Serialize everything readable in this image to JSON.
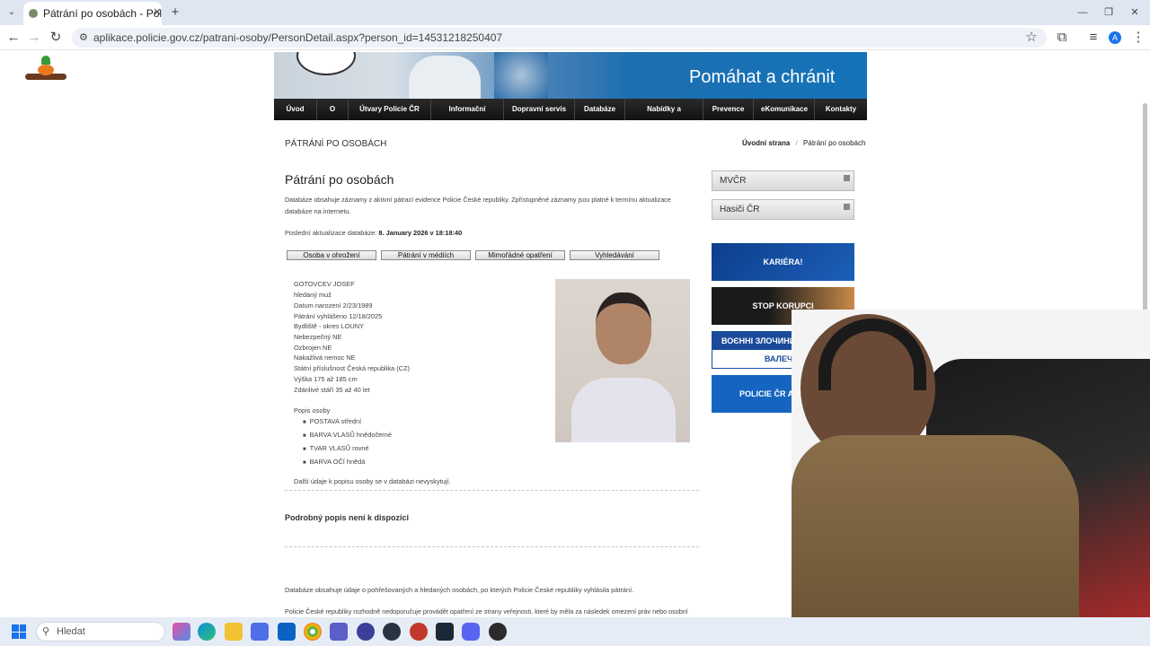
{
  "browser": {
    "tab_title": "Pátrání po osobách - Policie Če",
    "url": "aplikace.policie.gov.cz/patrani-osoby/PersonDetail.aspx?person_id=14531218250407",
    "new_tab": "+",
    "minimize": "—",
    "restore": "❐",
    "close": "✕",
    "profile": "A"
  },
  "header": {
    "slogan": "Pomáhat a chránit",
    "nav": [
      "Úvod",
      "O nás",
      "Útvary Policie ČR",
      "Informační servis",
      "Dopravní servis",
      "Databáze",
      "Nabídky a zakázky",
      "Prevence",
      "eKomunikace",
      "Kontakty"
    ]
  },
  "page": {
    "section": "PÁTRÁNÍ PO OSOBÁCH",
    "breadcrumb_home": "Úvodní strana",
    "breadcrumb_sep": "/",
    "breadcrumb_current": "Pátrání po osobách",
    "title": "Pátrání po osobách",
    "intro_line1": "Databáze obsahuje záznamy z aktivní pátrací evidence Policie České republiky. Zpřístupněné záznamy jsou platné k termínu aktualizace",
    "intro_line2": "databáze na internetu.",
    "update_label": "Poslední aktualizace databáze:",
    "update_value": "8. January 2026 v 18:18:40",
    "buttons": [
      "Osoba v ohrožení",
      "Pátrání v médiích",
      "Mimořádné opatření",
      "Vyhledávání"
    ]
  },
  "person": {
    "name": "GOTOVCEV JOSEF",
    "status": "hledaný muž",
    "birth": "Datum narození 2/23/1989",
    "declared": "Pátrání vyhlášeno 12/18/2025",
    "residence": "Bydliště - okres LOUNY",
    "dangerous": "Nebezpečný NE",
    "armed": "Ozbrojen NE",
    "disease": "Nakažlivá nemoc NE",
    "citizenship": "Státní příslušnost Česká republika (CZ)",
    "height": "Výška 175 až 185 cm",
    "age": "Zdánlivé stáří 35 až 40 let",
    "desc_label": "Popis osoby",
    "desc": [
      "POSTAVA střední",
      "BARVA VLASŮ hnědočerné",
      "TVAR VLASŮ rovné",
      "BARVA OČÍ hnědá"
    ],
    "no_more": "Další údaje k popisu osoby se v databázi nevyskytují."
  },
  "details": {
    "heading": "Podrobný popis není k dispozici",
    "footer1": "Databáze obsahuje údaje o pohřešovaných a hledaných osobách, po kterých Policie České republiky vyhlásila pátrání.",
    "footer2": "Policie České republiky rozhodně nedoporučuje provádět opatření ze strany veřejnosti, které by měla za následek omezení práv nebo osobní"
  },
  "sidebar": {
    "links": [
      "MVČR",
      "Hasiči ČR"
    ],
    "banners": [
      "KARIÉRA!",
      "STOP KORUPCI",
      "ВОЄННІ ЗЛОЧИНИ",
      "ВАЛЕЧ",
      "POLICIE ČR A EU"
    ]
  },
  "taskbar": {
    "search_placeholder": "Hledat"
  }
}
